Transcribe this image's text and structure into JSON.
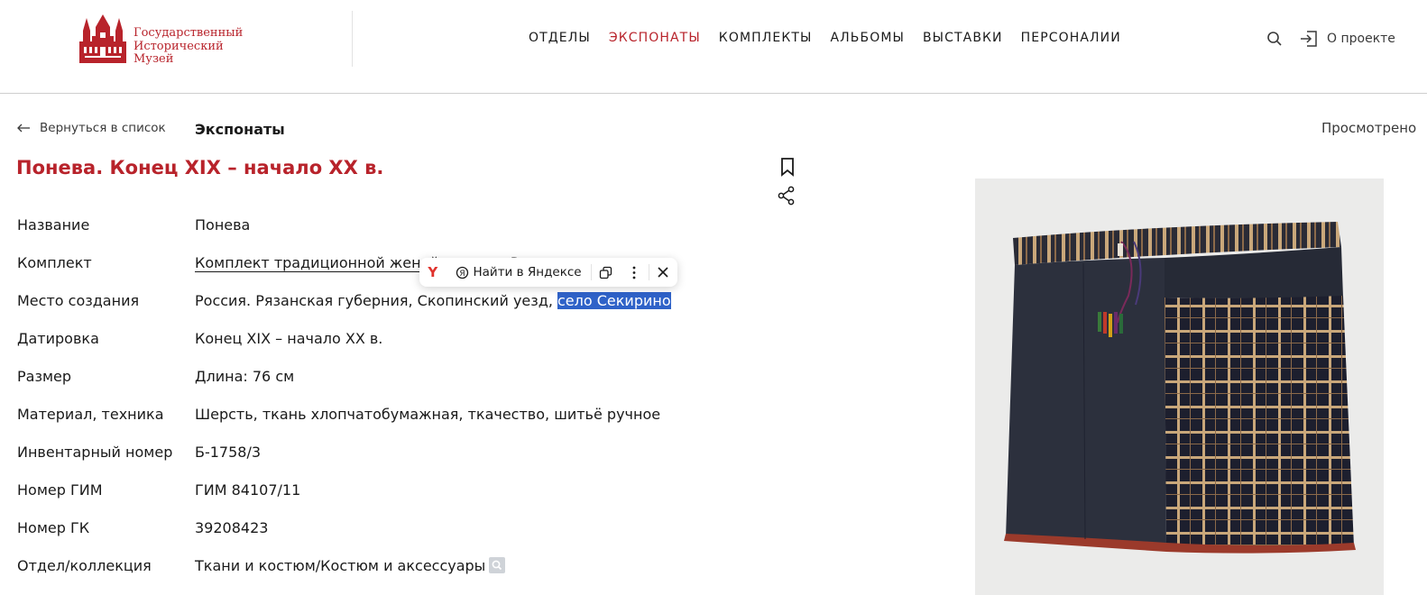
{
  "header": {
    "logo": {
      "lines": [
        "Государственный",
        "Исторический",
        "Музей"
      ]
    },
    "nav": [
      {
        "label": "ОТДЕЛЫ",
        "active": false
      },
      {
        "label": "ЭКСПОНАТЫ",
        "active": true
      },
      {
        "label": "КОМПЛЕКТЫ",
        "active": false
      },
      {
        "label": "АЛЬБОМЫ",
        "active": false
      },
      {
        "label": "ВЫСТАВКИ",
        "active": false
      },
      {
        "label": "ПЕРСОНАЛИИ",
        "active": false
      }
    ],
    "about_label": "О проекте"
  },
  "subbar": {
    "back_label": "Вернуться в список",
    "section_title": "Экспонаты",
    "viewed_label": "Просмотрено"
  },
  "item": {
    "title": "Понева. Конец XIX – начало XX в.",
    "properties": [
      {
        "label": "Название",
        "value": "Понева"
      },
      {
        "label": "Комплект",
        "value": "Комплект традиционной жен",
        "value_tail": "ой одежды Р"
      },
      {
        "label": "Место создания",
        "value": "Россия. Рязанская губерния, Скопинский уезд, ",
        "value_selected": "село Секирино"
      },
      {
        "label": "Датировка",
        "value": "Конец XIX – начало XX в."
      },
      {
        "label": "Размер",
        "value": "Длина: 76 см"
      },
      {
        "label": "Материал, техника",
        "value": "Шерсть, ткань хлопчатобумажная, ткачество, шитьё ручное"
      },
      {
        "label": "Инвентарный номер",
        "value": "Б-1758/3"
      },
      {
        "label": "Номер ГИМ",
        "value": "ГИМ 84107/11"
      },
      {
        "label": "Номер ГК",
        "value": "39208423"
      },
      {
        "label": "Отдел/коллекция",
        "value": "Ткани и костюм/Костюм и аксессуары"
      }
    ]
  },
  "yandex_popup": {
    "find_label": "Найти в Яндексе",
    "icons": [
      "yandex-browser-icon",
      "copy-icon",
      "more-icon",
      "close-icon"
    ]
  },
  "colors": {
    "accent": "#b8232b",
    "selection": "#2f62c8"
  }
}
